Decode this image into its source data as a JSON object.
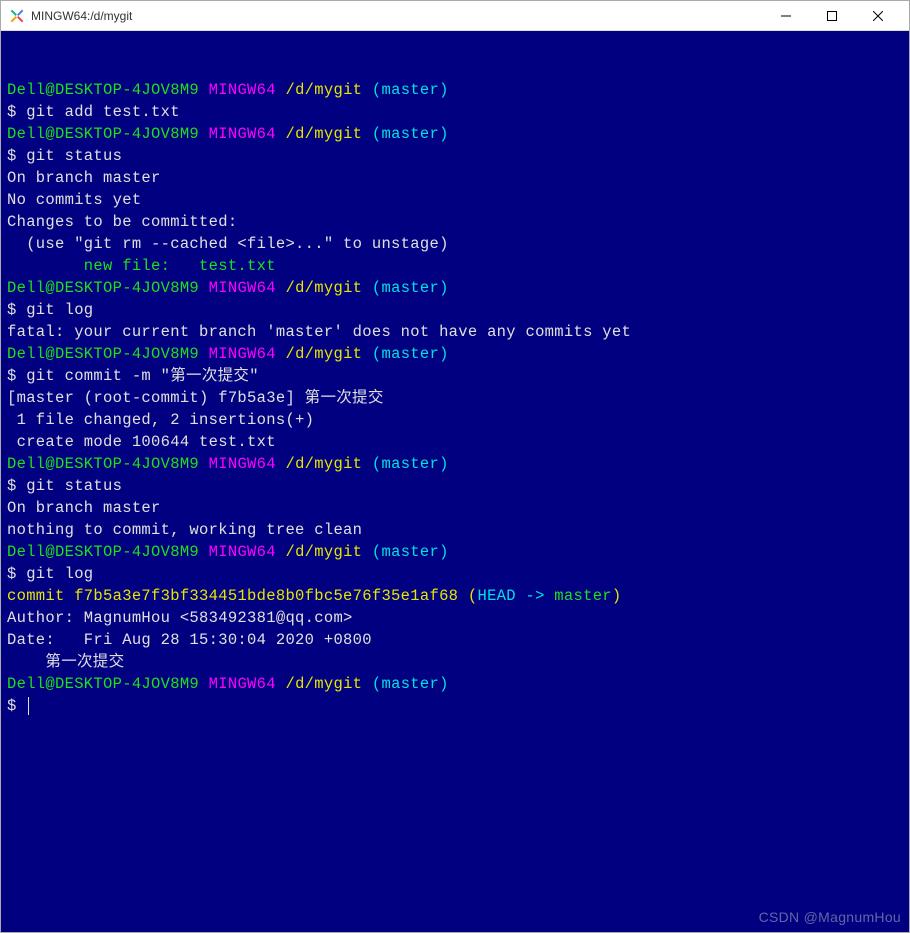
{
  "window": {
    "title": "MINGW64:/d/mygit"
  },
  "prompt": {
    "user": "Dell@DESKTOP-4JOV8M9",
    "env": "MINGW64",
    "path": "/d/mygit",
    "branch": "(master)",
    "symbol": "$"
  },
  "sessions": [
    {
      "cmd": "git add test.txt",
      "out": []
    },
    {
      "cmd": "git status",
      "out": [
        {
          "t": "On branch master",
          "c": "white"
        },
        {
          "t": "",
          "c": "white"
        },
        {
          "t": "No commits yet",
          "c": "white"
        },
        {
          "t": "",
          "c": "white"
        },
        {
          "t": "Changes to be committed:",
          "c": "white"
        },
        {
          "t": "  (use \"git rm --cached <file>...\" to unstage)",
          "c": "white"
        },
        {
          "t": "",
          "c": "white"
        },
        {
          "t": "        new file:   test.txt",
          "c": "green"
        },
        {
          "t": "",
          "c": "white"
        }
      ]
    },
    {
      "cmd": "git log",
      "out": [
        {
          "t": "fatal: your current branch 'master' does not have any commits yet",
          "c": "white"
        }
      ]
    },
    {
      "cmd": "git commit -m \"第一次提交\"",
      "out": [
        {
          "t": "[master (root-commit) f7b5a3e] 第一次提交",
          "c": "white"
        },
        {
          "t": " 1 file changed, 2 insertions(+)",
          "c": "white"
        },
        {
          "t": " create mode 100644 test.txt",
          "c": "white"
        }
      ]
    },
    {
      "cmd": "git status",
      "out": [
        {
          "t": "On branch master",
          "c": "white"
        },
        {
          "t": "nothing to commit, working tree clean",
          "c": "white"
        }
      ]
    },
    {
      "cmd": "git log",
      "outspec": "log"
    }
  ],
  "gitlog": {
    "commitLabel": "commit",
    "hash": "f7b5a3e7f3bf334451bde8b0fbc5e76f35e1af68",
    "refOpen": "(",
    "head": "HEAD -> ",
    "refBranch": "master",
    "refClose": ")",
    "author": "Author: MagnumHou <583492381@qq.com>",
    "date": "Date:   Fri Aug 28 15:30:04 2020 +0800",
    "msg": "    第一次提交"
  },
  "watermark": "CSDN @MagnumHou"
}
